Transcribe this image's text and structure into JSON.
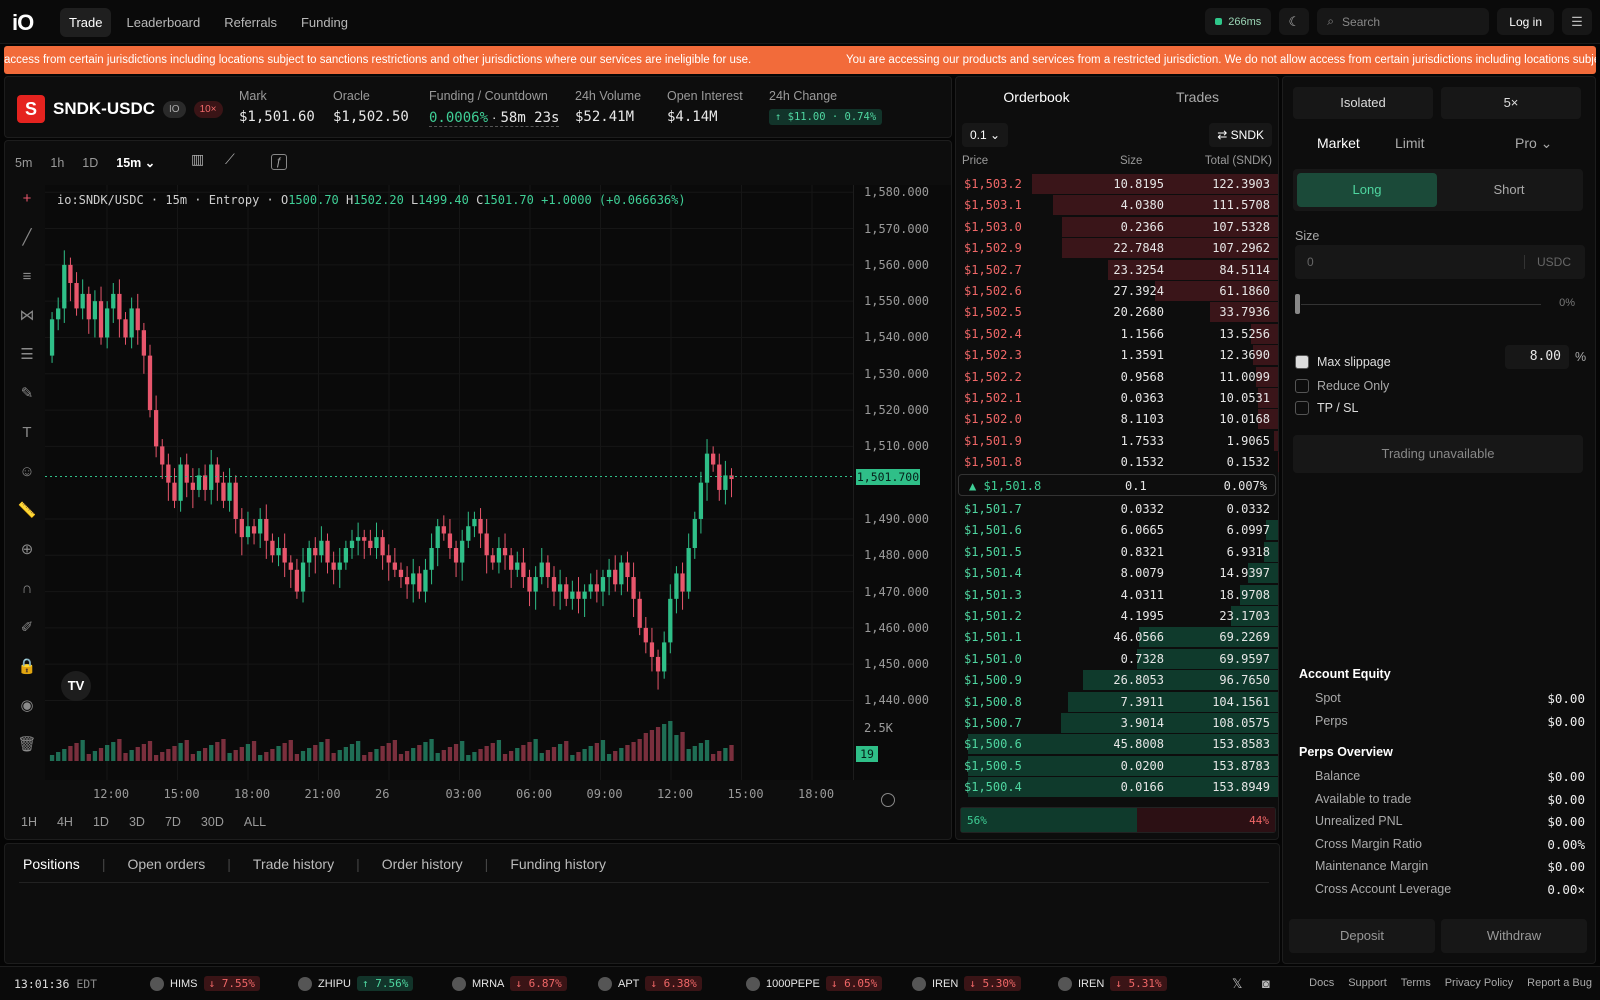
{
  "topnav": {
    "logo": "iO",
    "items": [
      "Trade",
      "Leaderboard",
      "Referrals",
      "Funding"
    ],
    "ping": "266ms",
    "search_placeholder": "Search",
    "login": "Log in"
  },
  "banner": {
    "text_left": "access from certain jurisdictions including locations subject to sanctions restrictions and other jurisdictions where our services are ineligible for use.",
    "text_right": "You are accessing our products and services from a restricted jurisdiction. We do not allow access from certain jurisdictions including locations subje"
  },
  "market": {
    "symbol": "SNDK-USDC",
    "icon_letter": "S",
    "tag_io": "IO",
    "tag_lev": "10×",
    "mark_label": "Mark",
    "mark": "$1,501.60",
    "oracle_label": "Oracle",
    "oracle": "$1,502.50",
    "funding_label": "Funding / Countdown",
    "funding": "0.0006%",
    "countdown": "58m 23s",
    "vol_label": "24h Volume",
    "vol": "$52.41M",
    "oi_label": "Open Interest",
    "oi": "$4.14M",
    "chg_label": "24h Change",
    "chg": "↑ $11.00 · 0.74%"
  },
  "chart": {
    "timeframes": [
      "5m",
      "1h",
      "1D",
      "15m ⌄"
    ],
    "legend_sym": "io:SNDK/USDC · 15m · Entropy · ",
    "o": "1500.70",
    "h": "1502.20",
    "l": "1499.40",
    "c": "1501.70",
    "chg": "+1.0000 (+0.066636%)",
    "price_tag": "1,501.700",
    "vol_axis": "2.5K",
    "vol_tag": "19",
    "ranges": [
      "1H",
      "4H",
      "1D",
      "3D",
      "7D",
      "30D",
      "ALL"
    ],
    "tv_logo": "TV",
    "ylabels": [
      "1,580.000",
      "1,570.000",
      "1,560.000",
      "1,550.000",
      "1,540.000",
      "1,530.000",
      "1,520.000",
      "1,510.000",
      "1,490.000",
      "1,480.000",
      "1,470.000",
      "1,460.000",
      "1,450.000",
      "1,440.000"
    ],
    "xlabels": [
      "12:00",
      "15:00",
      "18:00",
      "21:00",
      "26",
      "03:00",
      "06:00",
      "09:00",
      "12:00",
      "15:00",
      "18:00"
    ]
  },
  "chart_data": {
    "type": "candlestick",
    "title": "io:SNDK/USDC · 15m",
    "ylim": [
      1436,
      1582
    ],
    "closes": [
      1545,
      1548,
      1560,
      1555,
      1548,
      1552,
      1545,
      1550,
      1540,
      1548,
      1552,
      1545,
      1540,
      1548,
      1542,
      1535,
      1520,
      1510,
      1505,
      1500,
      1495,
      1505,
      1500,
      1498,
      1502,
      1498,
      1505,
      1500,
      1495,
      1500,
      1490,
      1485,
      1488,
      1486,
      1490,
      1484,
      1480,
      1482,
      1478,
      1476,
      1470,
      1478,
      1482,
      1480,
      1484,
      1478,
      1476,
      1478,
      1482,
      1484,
      1485,
      1484,
      1482,
      1485,
      1480,
      1478,
      1476,
      1474,
      1472,
      1475,
      1470,
      1476,
      1482,
      1488,
      1486,
      1482,
      1478,
      1484,
      1488,
      1490,
      1486,
      1480,
      1478,
      1482,
      1480,
      1476,
      1478,
      1474,
      1470,
      1474,
      1478,
      1474,
      1470,
      1472,
      1468,
      1470,
      1468,
      1470,
      1472,
      1470,
      1474,
      1476,
      1472,
      1478,
      1474,
      1468,
      1460,
      1456,
      1452,
      1448,
      1456,
      1468,
      1475,
      1470,
      1482,
      1490,
      1500,
      1508,
      1505,
      1498,
      1502,
      1501
    ]
  },
  "orderbook": {
    "tab_ob": "Orderbook",
    "tab_trades": "Trades",
    "tick": "0.1 ⌄",
    "sym": "⇄ SNDK",
    "head": [
      "Price",
      "Size",
      "Total (SNDK)"
    ],
    "asks": [
      [
        "$1,503.2",
        "10.8195",
        "122.3903"
      ],
      [
        "$1,503.1",
        "4.0380",
        "111.5708"
      ],
      [
        "$1,503.0",
        "0.2366",
        "107.5328"
      ],
      [
        "$1,502.9",
        "22.7848",
        "107.2962"
      ],
      [
        "$1,502.7",
        "23.3254",
        "84.5114"
      ],
      [
        "$1,502.6",
        "27.3924",
        "61.1860"
      ],
      [
        "$1,502.5",
        "20.2680",
        "33.7936"
      ],
      [
        "$1,502.4",
        "1.1566",
        "13.5256"
      ],
      [
        "$1,502.3",
        "1.3591",
        "12.3690"
      ],
      [
        "$1,502.2",
        "0.9568",
        "11.0099"
      ],
      [
        "$1,502.1",
        "0.0363",
        "10.0531"
      ],
      [
        "$1,502.0",
        "8.1103",
        "10.0168"
      ],
      [
        "$1,501.9",
        "1.7533",
        "1.9065"
      ],
      [
        "$1,501.8",
        "0.1532",
        "0.1532"
      ]
    ],
    "mid_price": "▲ $1,501.8",
    "mid_spread": "0.1",
    "mid_pct": "0.007%",
    "bids": [
      [
        "$1,501.7",
        "0.0332",
        "0.0332"
      ],
      [
        "$1,501.6",
        "6.0665",
        "6.0997"
      ],
      [
        "$1,501.5",
        "0.8321",
        "6.9318"
      ],
      [
        "$1,501.4",
        "8.0079",
        "14.9397"
      ],
      [
        "$1,501.3",
        "4.0311",
        "18.9708"
      ],
      [
        "$1,501.2",
        "4.1995",
        "23.1703"
      ],
      [
        "$1,501.1",
        "46.0566",
        "69.2269"
      ],
      [
        "$1,501.0",
        "0.7328",
        "69.9597"
      ],
      [
        "$1,500.9",
        "26.8053",
        "96.7650"
      ],
      [
        "$1,500.8",
        "7.3911",
        "104.1561"
      ],
      [
        "$1,500.7",
        "3.9014",
        "108.0575"
      ],
      [
        "$1,500.6",
        "45.8008",
        "153.8583"
      ],
      [
        "$1,500.5",
        "0.0200",
        "153.8783"
      ],
      [
        "$1,500.4",
        "0.0166",
        "153.8949"
      ]
    ],
    "buy_pct": "56%",
    "sell_pct": "44%"
  },
  "order": {
    "margin": "Isolated",
    "lev": "5×",
    "types": [
      "Market",
      "Limit",
      "Pro ⌄"
    ],
    "long": "Long",
    "short": "Short",
    "size_label": "Size",
    "size_placeholder": "0",
    "size_unit": "USDC",
    "slider_pct": "0%",
    "max_slip": "Max slippage",
    "slip_val": "8.00",
    "slip_unit": "%",
    "reduce": "Reduce Only",
    "tpsl": "TP / SL",
    "submit": "Trading unavailable"
  },
  "account": {
    "equity_title": "Account Equity",
    "rows1": [
      [
        "Spot",
        "$0.00"
      ],
      [
        "Perps",
        "$0.00"
      ]
    ],
    "perps_title": "Perps Overview",
    "rows2": [
      [
        "Balance",
        "$0.00"
      ],
      [
        "Available to trade",
        "$0.00"
      ],
      [
        "Unrealized PNL",
        "$0.00"
      ],
      [
        "Cross Margin Ratio",
        "0.00%"
      ],
      [
        "Maintenance Margin",
        "$0.00"
      ],
      [
        "Cross Account Leverage",
        "0.00×"
      ]
    ],
    "deposit": "Deposit",
    "withdraw": "Withdraw"
  },
  "positions": {
    "tabs": [
      "Positions",
      "Open orders",
      "Trade history",
      "Order history",
      "Funding history"
    ]
  },
  "footer": {
    "time": "13:01:36",
    "tz": "EDT",
    "tickers": [
      [
        "HIMS",
        "↓ 7.55%",
        "dn"
      ],
      [
        "ZHIPU",
        "↑ 7.56%",
        "up"
      ],
      [
        "MRNA",
        "↓ 6.87%",
        "dn"
      ],
      [
        "APT",
        "↓ 6.38%",
        "dn"
      ],
      [
        "1000PEPE",
        "↓ 6.05%",
        "dn"
      ],
      [
        "IREN",
        "↓ 5.30%",
        "dn"
      ],
      [
        "IREN",
        "↓ 5.31%",
        "dn"
      ]
    ],
    "links": [
      "Docs",
      "Support",
      "Terms",
      "Privacy Policy",
      "Report a Bug"
    ]
  },
  "colors": {
    "up": "#2fbf88",
    "down": "#e8566c",
    "banner": "#f26b3a"
  }
}
